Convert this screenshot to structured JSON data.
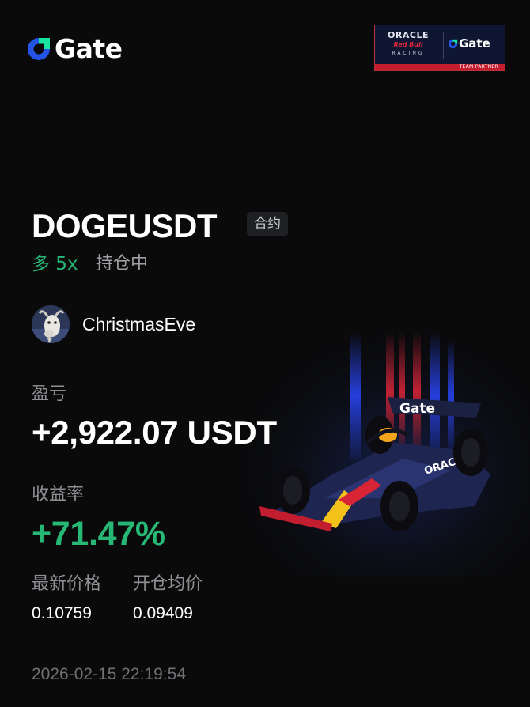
{
  "brand": {
    "name": "Gate",
    "logo_icon": "gate-logo-icon"
  },
  "partner_badge": {
    "oracle": "ORACLE",
    "redbull": "Red Bull",
    "racing": "RACING",
    "gate": "Gate",
    "caption": "TEAM PARTNER"
  },
  "position": {
    "pair": "DOGEUSDT",
    "type_tag": "合约",
    "side": "多 5x",
    "status": "持仓中"
  },
  "user": {
    "name": "ChristmasEve",
    "avatar_icon": "goat-avatar-icon"
  },
  "pnl": {
    "label": "盈亏",
    "value": "+2,922.07 USDT"
  },
  "roi": {
    "label": "收益率",
    "value": "+71.47%"
  },
  "prices": {
    "latest_label": "最新价格",
    "latest_value": "0.10759",
    "entry_label": "开仓均价",
    "entry_value": "0.09409"
  },
  "timestamp": "2026-02-15 22:19:54",
  "colors": {
    "background": "#0a0a0b",
    "positive": "#27b876",
    "brand_blue": "#2354e6",
    "brand_green": "#17e6a1"
  }
}
